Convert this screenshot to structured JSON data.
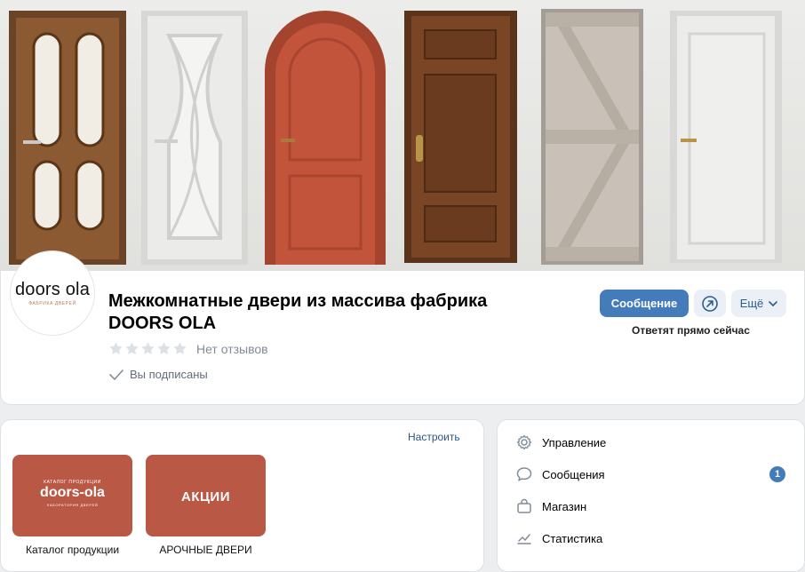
{
  "group": {
    "title": "Межкомнатные двери из массива фабрика DOORS OLA",
    "avatar_logo": "doors ola",
    "avatar_sub": "ФАБРИКА ДВЕРЕЙ",
    "rating_text": "Нет отзывов",
    "subscribed_text": "Вы подписаны"
  },
  "actions": {
    "message_label": "Сообщение",
    "more_label": "Ещё",
    "reply_note": "Ответят прямо сейчас"
  },
  "links": {
    "configure_label": "Настроить",
    "tiles": [
      {
        "top": "КАТАЛОГ ПРОДУКЦИИ",
        "logo": "doors-ola",
        "sub": "ЛАБОРАТОРИЯ ДВЕРЕЙ",
        "label": "Каталог продукции"
      },
      {
        "text": "АКЦИИ",
        "label": "АРОЧНЫЕ ДВЕРИ"
      }
    ]
  },
  "menu": {
    "items": [
      {
        "label": "Управление",
        "icon": "gear-icon"
      },
      {
        "label": "Сообщения",
        "icon": "chat-icon",
        "badge": "1"
      },
      {
        "label": "Магазин",
        "icon": "bag-icon"
      },
      {
        "label": "Статистика",
        "icon": "chart-icon"
      }
    ]
  },
  "colors": {
    "accent": "#447bba",
    "tile": "#b95844"
  }
}
